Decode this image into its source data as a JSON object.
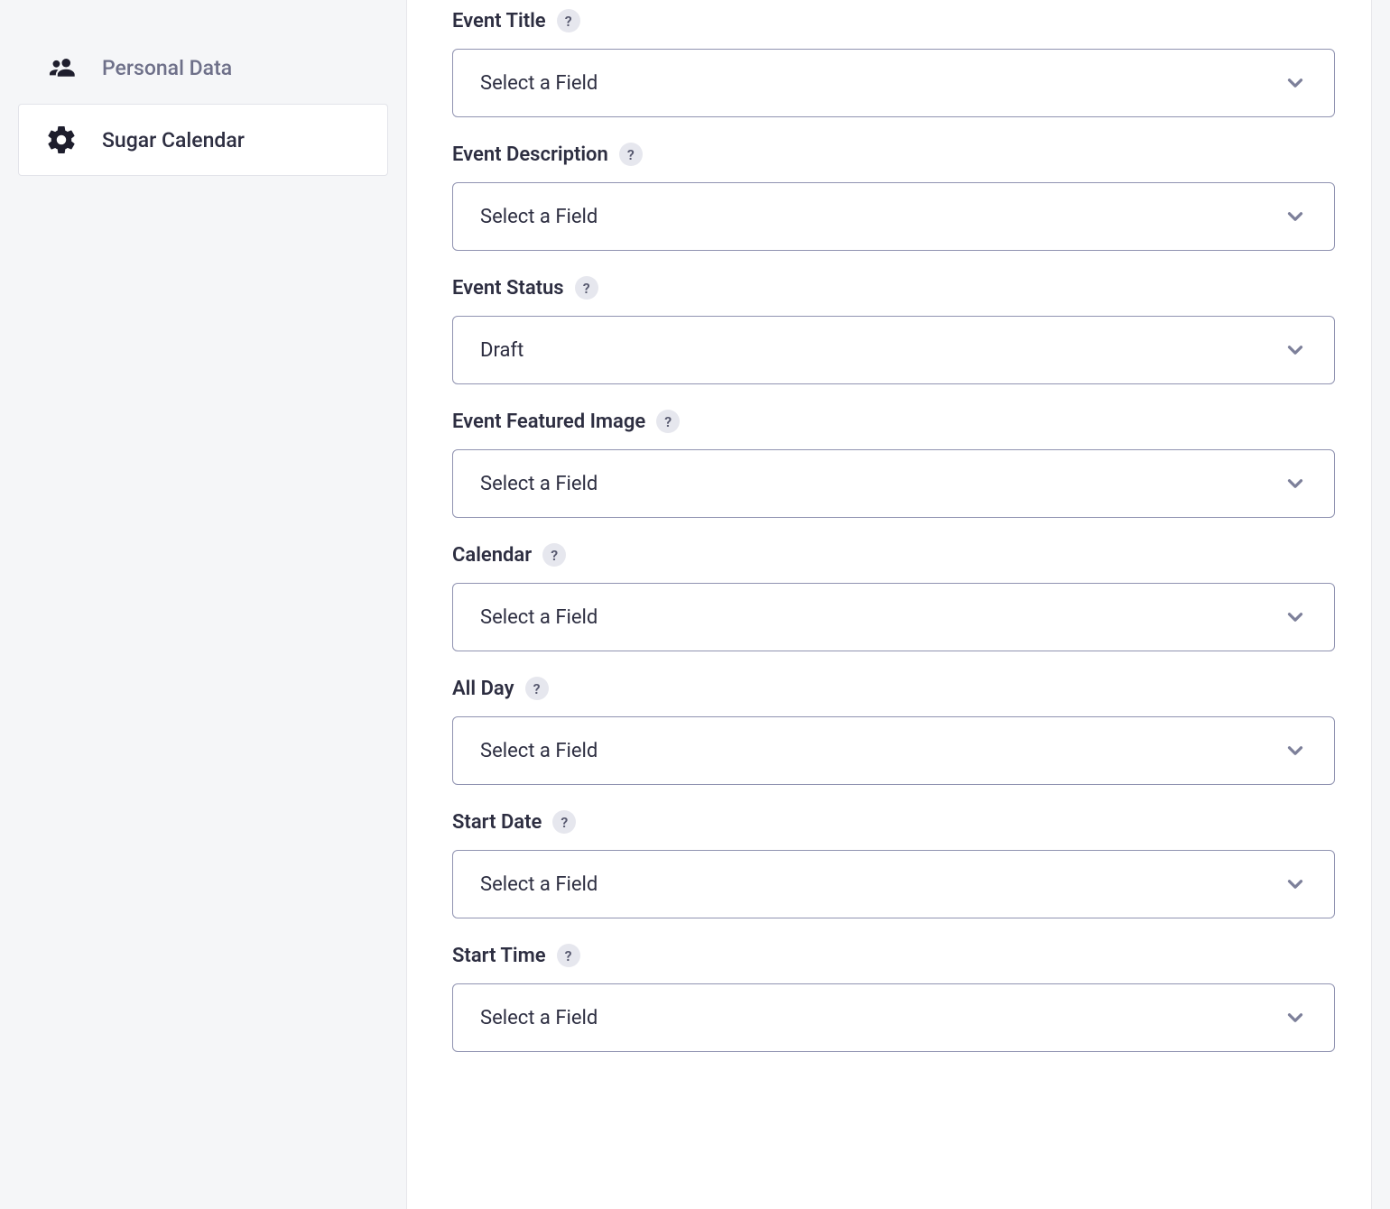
{
  "sidebar": {
    "items": [
      {
        "label": "Personal Data",
        "icon": "people-icon",
        "active": false
      },
      {
        "label": "Sugar Calendar",
        "icon": "gear-icon",
        "active": true
      }
    ]
  },
  "form": {
    "select_placeholder": "Select a Field",
    "help_glyph": "?",
    "fields": [
      {
        "label": "Event Title",
        "value": "Select a Field"
      },
      {
        "label": "Event Description",
        "value": "Select a Field"
      },
      {
        "label": "Event Status",
        "value": "Draft"
      },
      {
        "label": "Event Featured Image",
        "value": "Select a Field"
      },
      {
        "label": "Calendar",
        "value": "Select a Field"
      },
      {
        "label": "All Day",
        "value": "Select a Field"
      },
      {
        "label": "Start Date",
        "value": "Select a Field"
      },
      {
        "label": "Start Time",
        "value": "Select a Field"
      }
    ]
  }
}
